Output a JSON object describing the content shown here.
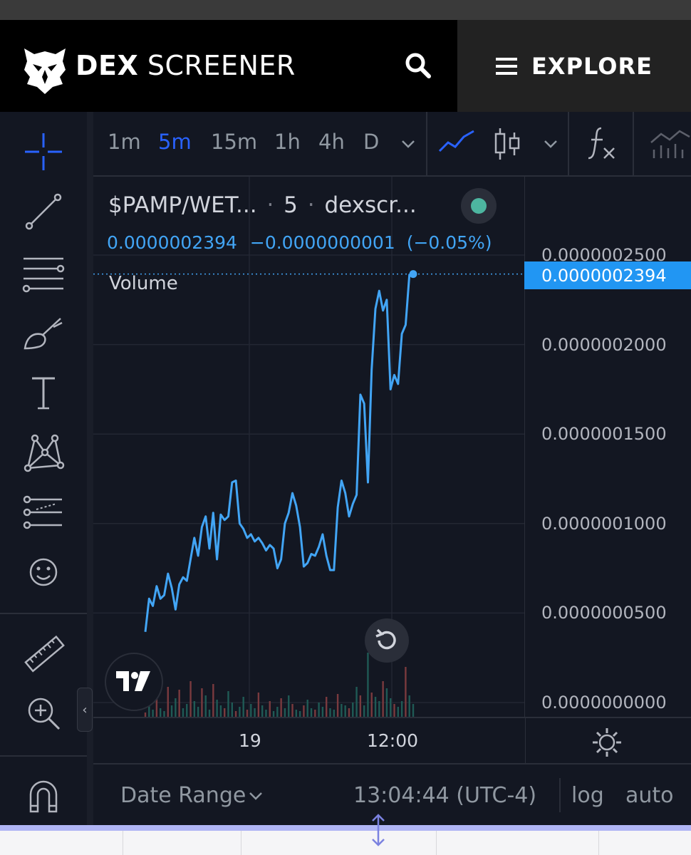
{
  "header": {
    "brand_bold": "DEX",
    "brand_light": "SCREENER",
    "search_icon": "search-icon",
    "explore_label": "EXPLORE"
  },
  "timeframes": [
    "1m",
    "5m",
    "15m",
    "1h",
    "4h",
    "D"
  ],
  "active_timeframe": "5m",
  "legend": {
    "symbol": "$PAMP/WET...",
    "dot1": "·",
    "interval": "5",
    "dot2": "·",
    "source": "dexscr...",
    "price": "0.0000002394",
    "change": "−0.0000000001",
    "change_pct": "(−0.05%)",
    "volume_label": "Volume"
  },
  "price_axis": {
    "labels": [
      "0.0000002500",
      "0.0000002000",
      "0.0000001500",
      "0.0000001000",
      "0.0000000500",
      "0.0000000000"
    ],
    "current": "0.0000002394"
  },
  "time_axis": {
    "labels": [
      "19",
      "12:00"
    ]
  },
  "bottom_bar": {
    "date_range": "Date Range",
    "clock": "13:04:44 (UTC-4)",
    "log": "log",
    "auto": "auto"
  },
  "colors": {
    "background": "#131722",
    "line": "#42a5f5",
    "accent": "#2962ff",
    "up": "#26a69a",
    "down": "#ef5350"
  },
  "chart_data": {
    "type": "line",
    "ylim": [
      0,
      2.5e-07
    ],
    "yticks": [
      2.5e-07,
      2e-07,
      1.5e-07,
      1e-07,
      5e-08,
      0
    ],
    "x_ticks": [
      "19",
      "12:00"
    ],
    "series": [
      {
        "values": [
          3.95e-08,
          5.8e-08,
          5.4e-08,
          6.5e-08,
          5.8e-08,
          6e-08,
          7.2e-08,
          6.4e-08,
          5.2e-08,
          6.6e-08,
          7e-08,
          6.8e-08,
          8e-08,
          9.2e-08,
          8.2e-08,
          9.8e-08,
          1.04e-07,
          8.6e-08,
          1.06e-07,
          8e-08,
          1.05e-07,
          1.02e-07,
          1.04e-07,
          1.23e-07,
          1.24e-07,
          1e-07,
          9.7e-08,
          9.2e-08,
          9.4e-08,
          9e-08,
          9.2e-08,
          8.9e-08,
          8.5e-08,
          8.8e-08,
          8.6e-08,
          7.5e-08,
          8e-08,
          1e-07,
          1.06e-07,
          1.17e-07,
          1.1e-07,
          9.8e-08,
          7.6e-08,
          7.8e-08,
          8.3e-08,
          8.2e-08,
          8.7e-08,
          9.4e-08,
          8.2e-08,
          7.4e-08,
          7.4e-08,
          1.09e-07,
          1.24e-07,
          1.17e-07,
          1.04e-07,
          1.11e-07,
          1.16e-07,
          1.72e-07,
          1.67e-07,
          1.23e-07,
          1.86e-07,
          2.2e-07,
          2.3e-07,
          2.19e-07,
          2.25e-07,
          1.75e-07,
          1.83e-07,
          1.78e-07,
          2.06e-07,
          2.11e-07,
          2.39e-07,
          2.394e-07
        ]
      }
    ]
  }
}
